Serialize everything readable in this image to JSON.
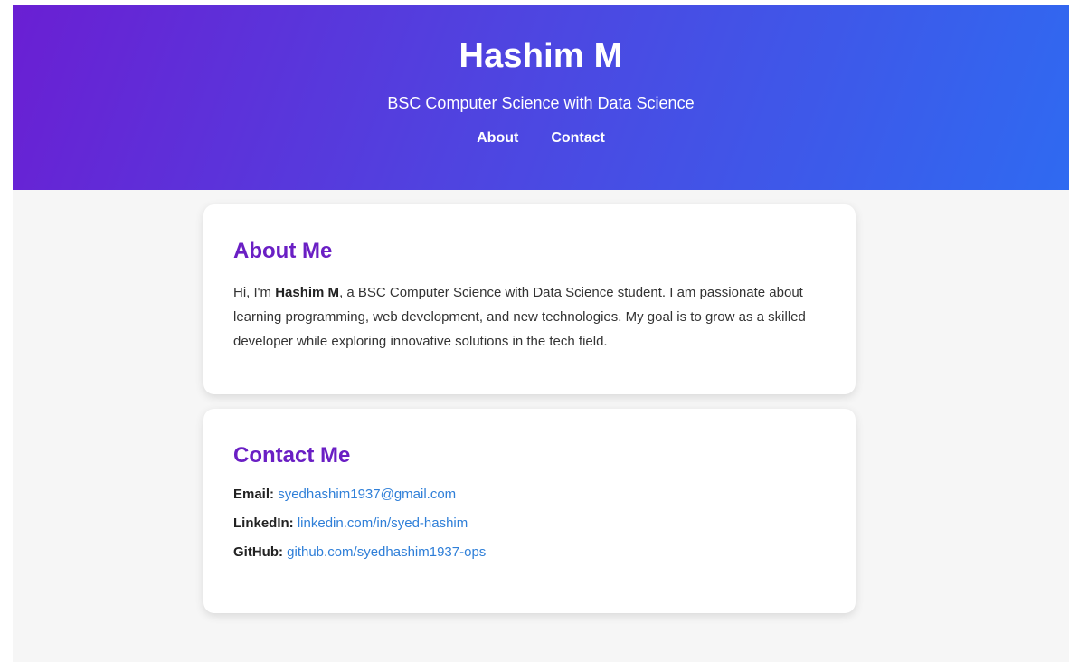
{
  "header": {
    "name": "Hashim M",
    "subtitle": "BSC Computer Science with Data Science",
    "nav": [
      {
        "label": "About"
      },
      {
        "label": "Contact"
      }
    ]
  },
  "about": {
    "title": "About Me",
    "text_before": "Hi, I'm ",
    "name_bold": "Hashim M",
    "text_after": ", a BSC Computer Science with Data Science student. I am passionate about learning programming, web development, and new technologies. My goal is to grow as a skilled developer while exploring innovative solutions in the tech field."
  },
  "contact": {
    "title": "Contact Me",
    "items": [
      {
        "label": "Email:",
        "value": "syedhashim1937@gmail.com"
      },
      {
        "label": "LinkedIn:",
        "value": "linkedin.com/in/syed-hashim"
      },
      {
        "label": "GitHub:",
        "value": "github.com/syedhashim1937-ops"
      }
    ]
  },
  "colors": {
    "gradient_start": "#6a1fd3",
    "gradient_end": "#2f6af1",
    "heading": "#6a1fc4",
    "link": "#2f7fd8",
    "background": "#f6f6f6"
  }
}
